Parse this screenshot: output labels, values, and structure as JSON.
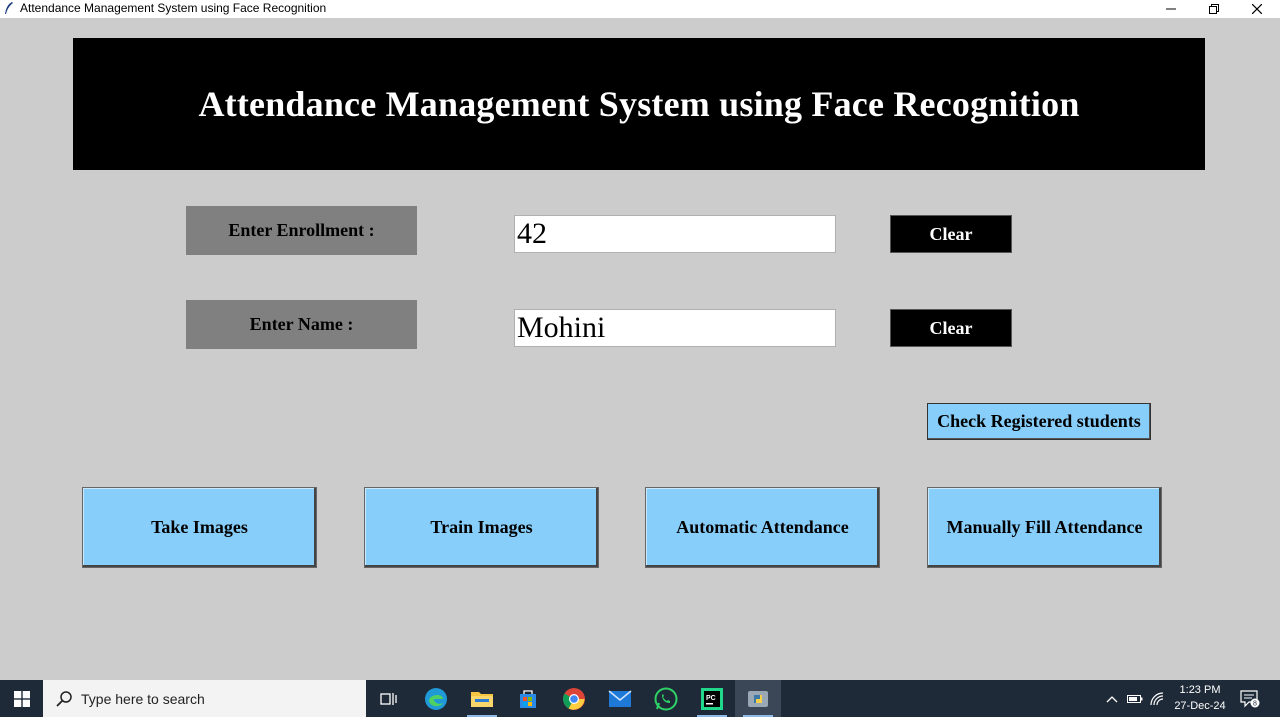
{
  "window": {
    "title": "Attendance Management System using Face Recognition"
  },
  "header": {
    "title": "Attendance Management System using Face Recognition"
  },
  "form": {
    "enrollment_label": "Enter Enrollment :",
    "enrollment_value": "42",
    "name_label": "Enter Name :",
    "name_value": "Mohini",
    "clear_label": "Clear"
  },
  "buttons": {
    "check_registered": "Check Registered students",
    "take_images": "Take Images",
    "train_images": "Train Images",
    "automatic_attendance": "Automatic Attendance",
    "manual_attendance": "Manually Fill Attendance"
  },
  "taskbar": {
    "search_placeholder": "Type here to search",
    "time": "1:23 PM",
    "date": "27-Dec-24",
    "notification_count": "8",
    "apps": [
      "task-view",
      "edge",
      "file-explorer",
      "microsoft-store",
      "chrome",
      "mail",
      "whatsapp",
      "pycharm",
      "python"
    ]
  },
  "colors": {
    "background": "#cccccc",
    "banner": "#000000",
    "label_box": "#808080",
    "action_button": "#87cefa",
    "taskbar": "#1f2a38"
  }
}
